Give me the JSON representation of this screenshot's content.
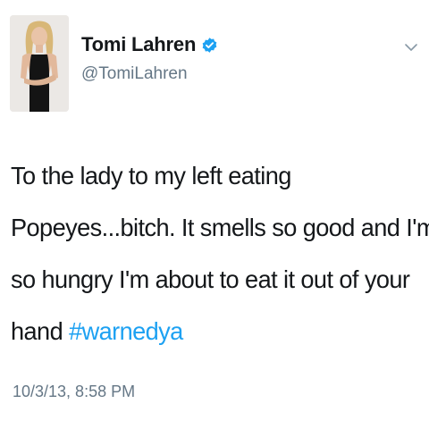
{
  "author": {
    "display_name": "Tomi Lahren",
    "handle": "@TomiLahren",
    "avatar_icon": "profile-photo",
    "verified_icon": "verified-badge-icon",
    "verified_color": "#1da1f2"
  },
  "menu": {
    "icon": "chevron-down-icon"
  },
  "tweet": {
    "line1": "To the lady to my left eating",
    "line2": "Popeyes...bitch. It smells so good and I'm",
    "line3": "so hungry I'm about to eat it out of your",
    "line4_text": "hand ",
    "hashtag": "#warnedya",
    "timestamp": "10/3/13, 8:58 PM"
  },
  "colors": {
    "text": "#14171a",
    "secondary": "#657786",
    "link": "#1da1f2",
    "background": "#ffffff"
  }
}
